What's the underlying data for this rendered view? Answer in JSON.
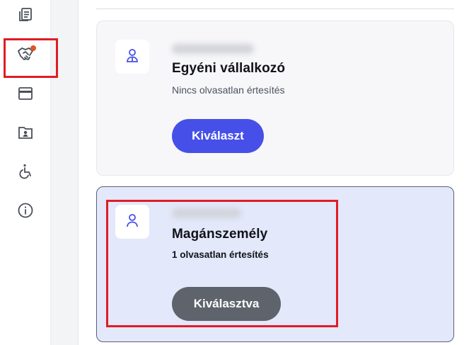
{
  "sidebar": {
    "items": [
      {
        "icon": "documents-icon"
      },
      {
        "icon": "handshake-icon",
        "has_notification_dot": true,
        "selected": true
      },
      {
        "icon": "card-icon"
      },
      {
        "icon": "contact-folder-icon"
      },
      {
        "icon": "accessibility-icon"
      },
      {
        "icon": "info-icon"
      }
    ]
  },
  "accounts": [
    {
      "type": "Egyéni vállalkozó",
      "notifications": "Nincs olvasatlan értesítés",
      "button_label": "Kiválaszt",
      "selected": false
    },
    {
      "type": "Magánszemély",
      "notifications": "1 olvasatlan értesítés",
      "button_label": "Kiválasztva",
      "selected": true
    }
  ],
  "colors": {
    "accent": "#4650e8",
    "selected_button": "#5f646c",
    "selected_card_bg": "#e3e8fb",
    "notification_dot": "#e2541f",
    "highlight": "#e01d25"
  }
}
